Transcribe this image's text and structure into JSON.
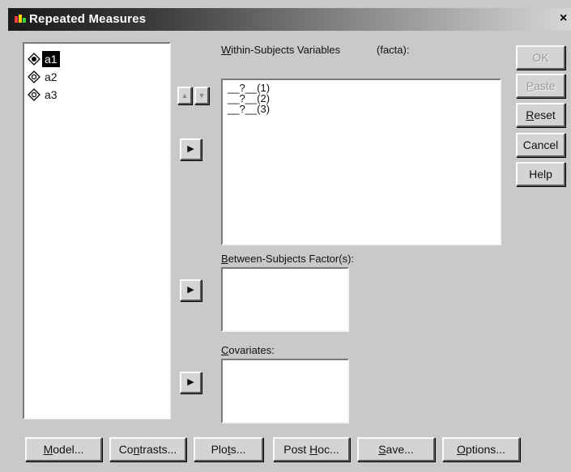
{
  "window": {
    "title": "Repeated Measures",
    "close_glyph": "×"
  },
  "variables": [
    {
      "label": "a1",
      "icon": "scale-variable-icon",
      "selected": true
    },
    {
      "label": "a2",
      "icon": "scale-variable-icon",
      "selected": false
    },
    {
      "label": "a3",
      "icon": "scale-variable-icon",
      "selected": false
    }
  ],
  "within": {
    "label_pre": "W",
    "label_rest": "ithin-Subjects Variables",
    "factor": "(facta):",
    "items": [
      "__?__(1)",
      "__?__(2)",
      "__?__(3)"
    ]
  },
  "between": {
    "label_pre": "B",
    "label_rest": "etween-Subjects Factor(s):"
  },
  "covariates": {
    "label_pre": "C",
    "label_rest": "ovariates:"
  },
  "side_buttons": {
    "ok": "OK",
    "paste_pre": "P",
    "paste_rest": "aste",
    "reset_pre": "R",
    "reset_rest": "eset",
    "cancel": "Cancel",
    "help": "Help"
  },
  "bottom_buttons": {
    "model_pre": "M",
    "model_rest": "odel...",
    "contrasts_a": "Co",
    "contrasts_u": "n",
    "contrasts_b": "trasts...",
    "plots_a": "Plo",
    "plots_u": "t",
    "plots_b": "s...",
    "posthoc_a": "Post ",
    "posthoc_u": "H",
    "posthoc_b": "oc...",
    "save_pre": "S",
    "save_rest": "ave...",
    "options_pre": "O",
    "options_rest": "ptions..."
  },
  "arrow_glyphs": {
    "up": "▲",
    "down": "▼",
    "right": "▶"
  },
  "colors": {
    "dialog_bg": "#c9c9c9",
    "selection": "#000000",
    "title_start": "#1a1a1a"
  }
}
